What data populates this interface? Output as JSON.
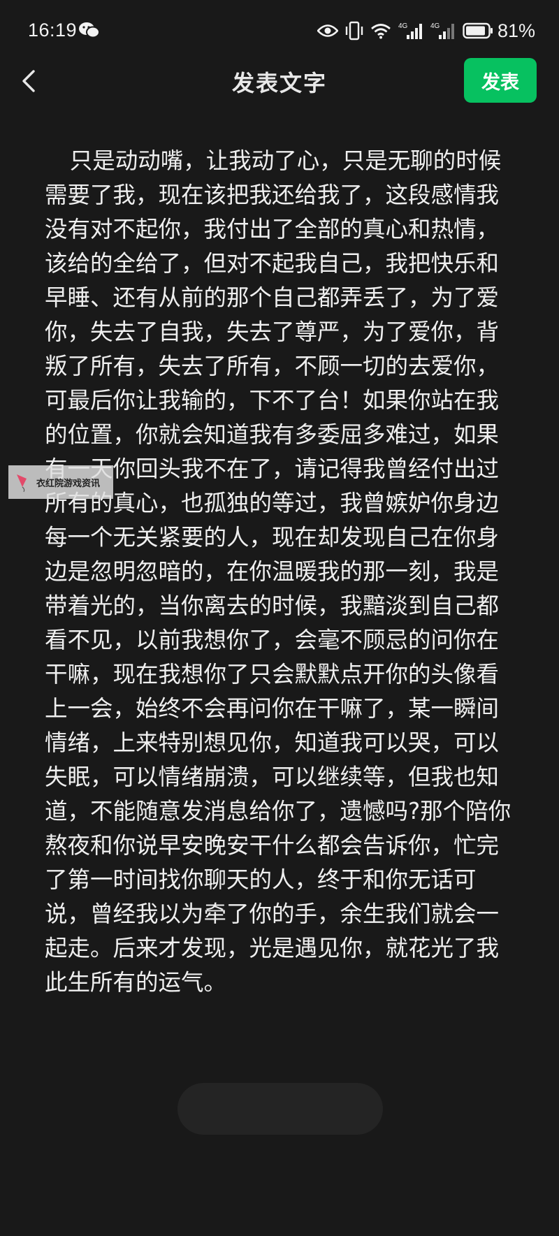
{
  "status_bar": {
    "time": "16:19",
    "battery_percent": "81%",
    "icons": [
      "wechat-icon",
      "eye-icon",
      "vibrate-icon",
      "wifi-icon",
      "signal-4g-icon",
      "signal-4g-icon",
      "battery-icon"
    ]
  },
  "header": {
    "title": "发表文字",
    "publish_label": "发表",
    "back_icon": "chevron-left-icon"
  },
  "post": {
    "text": "只是动动嘴，让我动了心，只是无聊的时候需要了我，现在该把我还给我了，这段感情我没有对不起你，我付出了全部的真心和热情，该给的全给了，但对不起我自己，我把快乐和早睡、还有从前的那个自己都弄丢了，为了爱你，失去了自我，失去了尊严，为了爱你，背叛了所有，失去了所有，不顾一切的去爱你，可最后你让我输的，下不了台！如果你站在我的位置，你就会知道我有多委屈多难过，如果有一天你回头我不在了，请记得我曾经付出过所有的真心，也孤独的等过，我曾嫉妒你身边每一个无关紧要的人，现在却发现自己在你身边是忽明忽暗的，在你温暖我的那一刻，我是带着光的，当你离去的时候，我黯淡到自己都看不见，以前我想你了，会毫不顾忌的问你在干嘛，现在我想你了只会默默点开你的头像看上一会，始终不会再问你在干嘛了，某一瞬间情绪，上来特别想见你，知道我可以哭，可以失眠，可以情绪崩溃，可以继续等，但我也知道，不能随意发消息给你了，遗憾吗?那个陪你熬夜和你说早安晚安干什么都会告诉你，忙完了第一时间找你聊天的人，终于和你无话可说，曾经我以为牵了你的手，余生我们就会一起走。后来才发现，光是遇见你，就花光了我此生所有的运气。"
  },
  "watermark": {
    "text": "衣红院游戏资讯",
    "icon": "kite-icon"
  },
  "colors": {
    "background": "#191919",
    "accent": "#07c160",
    "text": "#efefef"
  }
}
